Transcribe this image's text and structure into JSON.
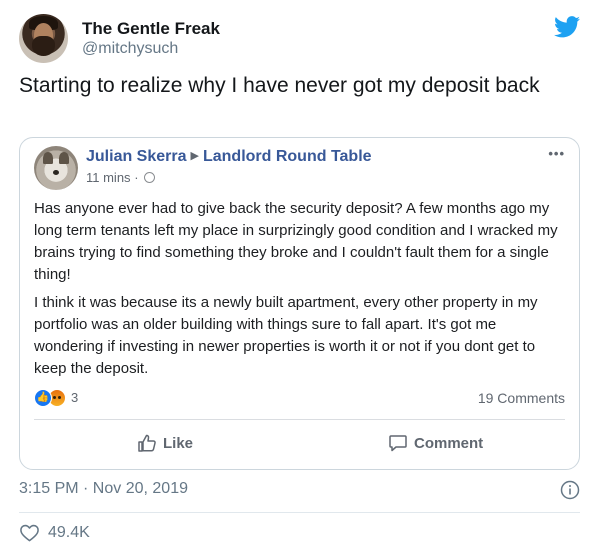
{
  "tweet": {
    "display_name": "The Gentle Freak",
    "handle": "@mitchysuch",
    "text": "Starting to realize why I have never got my deposit back",
    "timestamp": "3:15 PM · Nov 20, 2019",
    "likes": "49.4K"
  },
  "embedded_post": {
    "author": "Julian Skerra",
    "group": "Landlord Round Table",
    "time": "11 mins",
    "meta_separator": "·",
    "paragraphs": [
      "Has anyone ever had to give back the security deposit? A few months ago my long term tenants left my place in surprizingly good condition and I wracked my brains trying to find something they broke and I couldn't fault them for a single thing!",
      "I think it was because its a newly built apartment, every other property in my portfolio was an older building with things sure to fall apart. It's got me wondering if investing in newer properties is worth it or not if you dont get to keep the deposit."
    ],
    "reaction_count": "3",
    "comments": "19 Comments",
    "like_label": "Like",
    "comment_label": "Comment",
    "more_label": "•••"
  },
  "colors": {
    "twitter_blue": "#1da1f2",
    "facebook_link": "#385898",
    "muted": "#657786"
  },
  "icons": [
    "twitter-bird-icon",
    "globe-icon",
    "like-reaction-icon",
    "angry-reaction-icon",
    "thumbs-up-icon",
    "comment-bubble-icon",
    "info-icon",
    "heart-icon"
  ]
}
